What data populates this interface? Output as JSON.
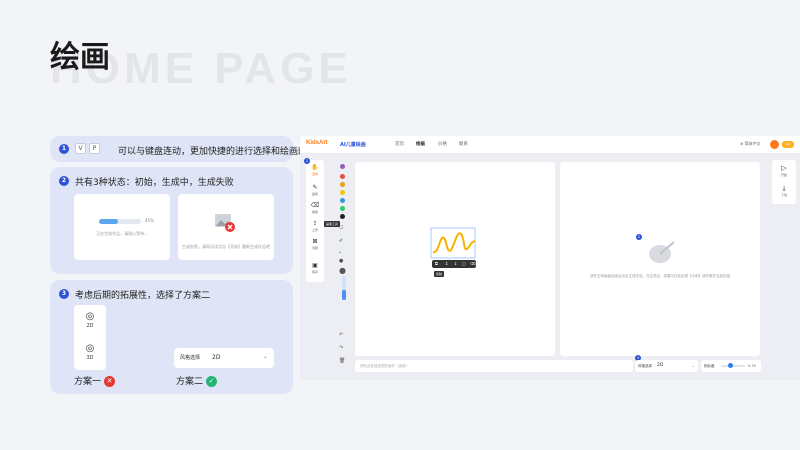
{
  "page": {
    "title": "绘画",
    "watermark": "HOME PAGE"
  },
  "notes": [
    {
      "num": "1",
      "text": "可以与键盘连动，更加快捷的进行选择和绘画的切换",
      "keys": [
        "V",
        "P"
      ]
    },
    {
      "num": "2",
      "text": "共有3种状态：初始，生成中，生成失败"
    },
    {
      "num": "3",
      "text": "考虑后期的拓展性，选择了方案二"
    }
  ],
  "states": {
    "generating": {
      "progress": 0.45,
      "progress_label": "45%",
      "text": "正在生成作品，请耐心等待..."
    },
    "failed": {
      "text": "生成失败，请再试试点击【开始】重新生成作品吧"
    }
  },
  "options": {
    "one": {
      "label": "方案一",
      "dims": [
        "2D",
        "3D"
      ]
    },
    "two": {
      "label": "方案二",
      "select_label": "风格选择",
      "select_value": "2D"
    }
  },
  "app": {
    "logo": "KidsArt",
    "name": "AI儿童绘画",
    "nav": [
      "首页",
      "绘画",
      "价格",
      "联系"
    ],
    "nav_active": 1,
    "lang": "简体中文",
    "vip": "VIP",
    "tools": [
      "选择",
      "画笔",
      "擦除",
      "上传",
      "清屏",
      "保存"
    ],
    "tooltip": "画笔工具",
    "palette_colors": [
      "#9b59b6",
      "#e74c3c",
      "#f39c12",
      "#f1c40f",
      "#3498db",
      "#2ecc71",
      "#222222"
    ],
    "selection_tooltip": "复制",
    "result_text": "请在左侧画板绘画后点击生成作品，在生成后，将展示在此区域【示例】请勿离开当前页面",
    "right_tools": [
      "开始",
      "下载"
    ],
    "prompt_placeholder": "请在此处描述您的画作（选填）",
    "style_label": "风格选择",
    "style_value": "2D",
    "sim_label": "相似度",
    "sim_value": "0.35",
    "sim_level": 0.35,
    "badges": [
      "1",
      "2",
      "3"
    ]
  }
}
